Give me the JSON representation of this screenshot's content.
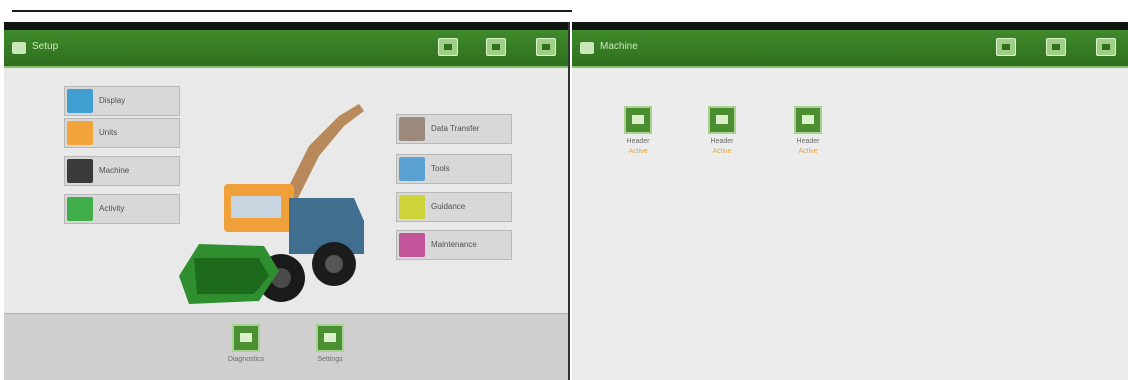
{
  "left_window": {
    "title": "Setup",
    "menu_left": [
      {
        "label": "Display",
        "icon": "display-icon",
        "color": "#3e9fd0"
      },
      {
        "label": "Units",
        "icon": "units-icon",
        "color": "#f2a43a"
      },
      {
        "label": "Machine",
        "icon": "machine-icon",
        "color": "#3a3a3a"
      },
      {
        "label": "Activity",
        "icon": "activity-icon",
        "color": "#3fae4b"
      }
    ],
    "menu_right": [
      {
        "label": "Data Transfer",
        "icon": "data-transfer-icon",
        "color": "#9b8a7c"
      },
      {
        "label": "Tools",
        "icon": "tools-icon",
        "color": "#5aa0d0"
      },
      {
        "label": "Guidance",
        "icon": "guidance-icon",
        "color": "#cdd43a"
      },
      {
        "label": "Maintenance",
        "icon": "maintenance-icon",
        "color": "#c3569b"
      }
    ],
    "bottom_items": [
      {
        "label": "Diagnostics"
      },
      {
        "label": "Settings"
      }
    ]
  },
  "right_window": {
    "title": "Machine",
    "tiles": [
      {
        "label": "Header",
        "sub": "Active"
      },
      {
        "label": "Header",
        "sub": "Active"
      },
      {
        "label": "Header",
        "sub": "Active"
      }
    ]
  },
  "colors": {
    "titlebar": "#2f6f1f",
    "accent_orange": "#e6a43a"
  }
}
